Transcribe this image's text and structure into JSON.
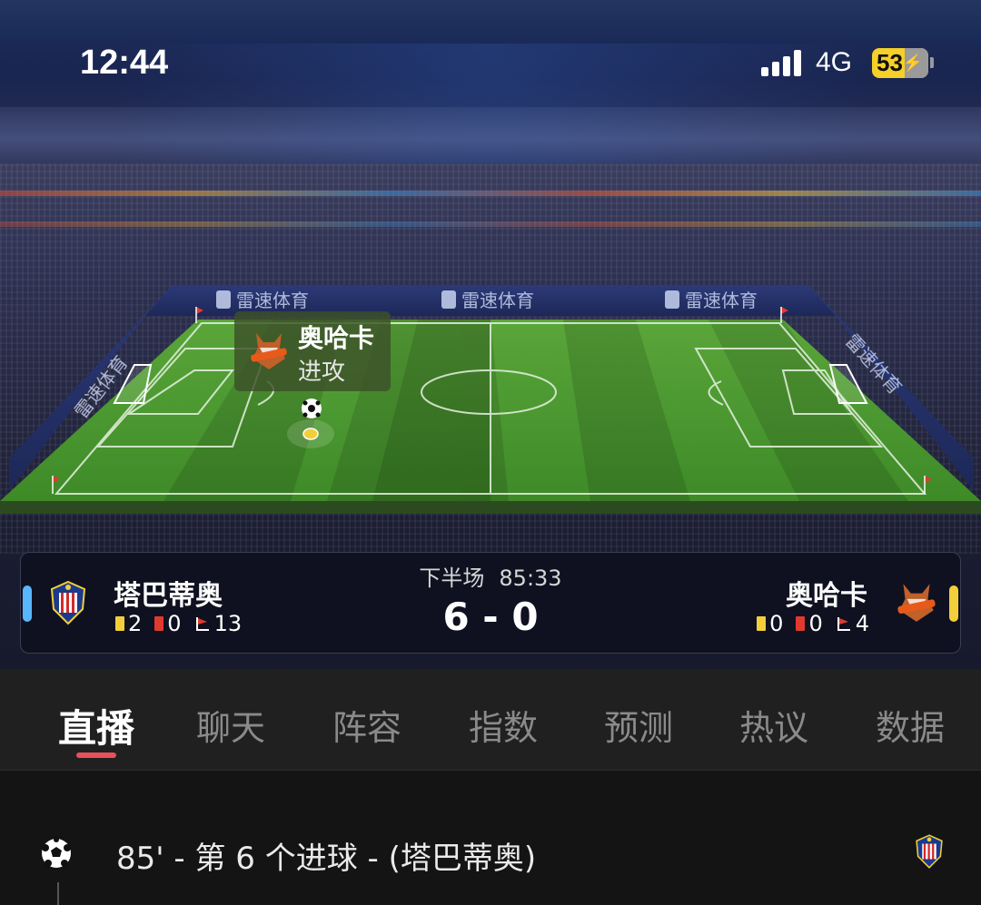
{
  "status_bar": {
    "time": "12:44",
    "network": "4G",
    "battery": "53"
  },
  "pitch": {
    "sponsor_text": "雷速体育",
    "popup": {
      "team": "奥哈卡",
      "action": "进攻"
    }
  },
  "match": {
    "period": "下半场",
    "clock": "85:33",
    "score": "6 - 0",
    "home": {
      "name": "塔巴蒂奥",
      "yellow": "2",
      "red": "0",
      "corners": "13",
      "color": "#58b6ff"
    },
    "away": {
      "name": "奥哈卡",
      "yellow": "0",
      "red": "0",
      "corners": "4",
      "color": "#f2cf3a"
    }
  },
  "tabs": [
    {
      "label": "直播",
      "active": true
    },
    {
      "label": "聊天"
    },
    {
      "label": "阵容"
    },
    {
      "label": "指数"
    },
    {
      "label": "预测"
    },
    {
      "label": "热议"
    },
    {
      "label": "数据"
    }
  ],
  "events": [
    {
      "text": "85' - 第 6 个进球 - (塔巴蒂奥)",
      "icon": "soccer-ball-icon",
      "team_badge": "home-team-badge"
    }
  ],
  "colors": {
    "accent": "#e8505b",
    "pitch": "#3f8a2c",
    "background": "#141414"
  }
}
